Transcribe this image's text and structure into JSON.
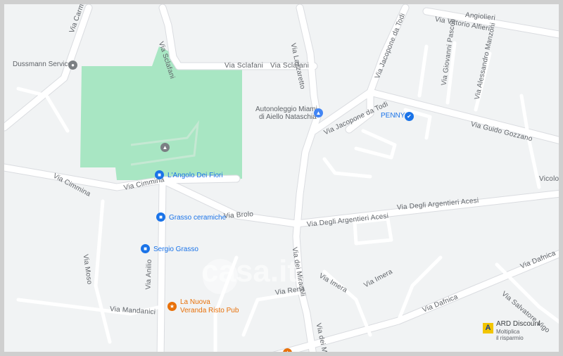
{
  "map": {
    "streets": {
      "via_sclafani_top": "Via Sclafani",
      "via_sclafani_h1": "Via Sclafani",
      "via_sclafani_h2": "Via Sclafani",
      "via_carmina": "Via Carmina",
      "via_lazzaretto": "Via Lazzaretto",
      "via_jacopone_top": "Via Jacopone da Todi",
      "via_jacopone_mid": "Via Jacopone da Todi",
      "via_vittorio_alfieri": "Via Vittorio Alfieri",
      "via_giovanni_pascoli": "Via Giovanni Pascoli",
      "via_alessandro_manzoni": "Via Alessandro Manzoni",
      "via_guido_gozzano": "Via Guido Gozzano",
      "via_cimmina_left": "Via Cimmina",
      "via_cimmina_right": "Via Cimmina",
      "via_brolo": "Via Brolo",
      "via_argentieri_1": "Via Degli Argentieri Acesi",
      "via_argentieri_2": "Via Degli Argentieri Acesi",
      "vicolo_ro": "Vicolo Ro",
      "via_del_miracoli_1": "Via dei Miracoli",
      "via_del_miracoli_2": "Via dei Miracoli",
      "via_moso": "Via Moso",
      "via_anilo": "Via Anilio",
      "via_mandanici": "Via Mandanici",
      "via_rena": "Via Rena",
      "via_imera_1": "Via Imera",
      "via_imera_2": "Via Imera",
      "via_dafnica_1": "Via Dafnica",
      "via_dafnica_2": "Via Dafnica",
      "via_salvatore_vigo": "Via Salvatore Vigo",
      "angioleri": "Angiolieri"
    },
    "pois": {
      "dussmann": "Dussmann Service",
      "autonoleggio_1": "Autonoleggio Miami",
      "autonoleggio_2": "di Aiello Nataschia",
      "penny": "PENNY",
      "angolo_fiori": "L'Angolo Dei Fiori",
      "grasso_ceramiche": "Grasso ceramiche",
      "sergio_grasso": "Sergio Grasso",
      "nuova_veranda_1": "La Nuova",
      "nuova_veranda_2": "Veranda Risto Pub",
      "ard_discount": "ARD Discount",
      "ard_sub1": "Moltiplica",
      "ard_sub2": "il risparmio",
      "ard_logo": "A"
    },
    "watermark": "casa.it",
    "colors": {
      "background": "#f1f3f4",
      "road": "#ffffff",
      "park": "#a8e6c3",
      "poi_blue": "#1a73e8",
      "poi_orange": "#e8710a"
    }
  }
}
